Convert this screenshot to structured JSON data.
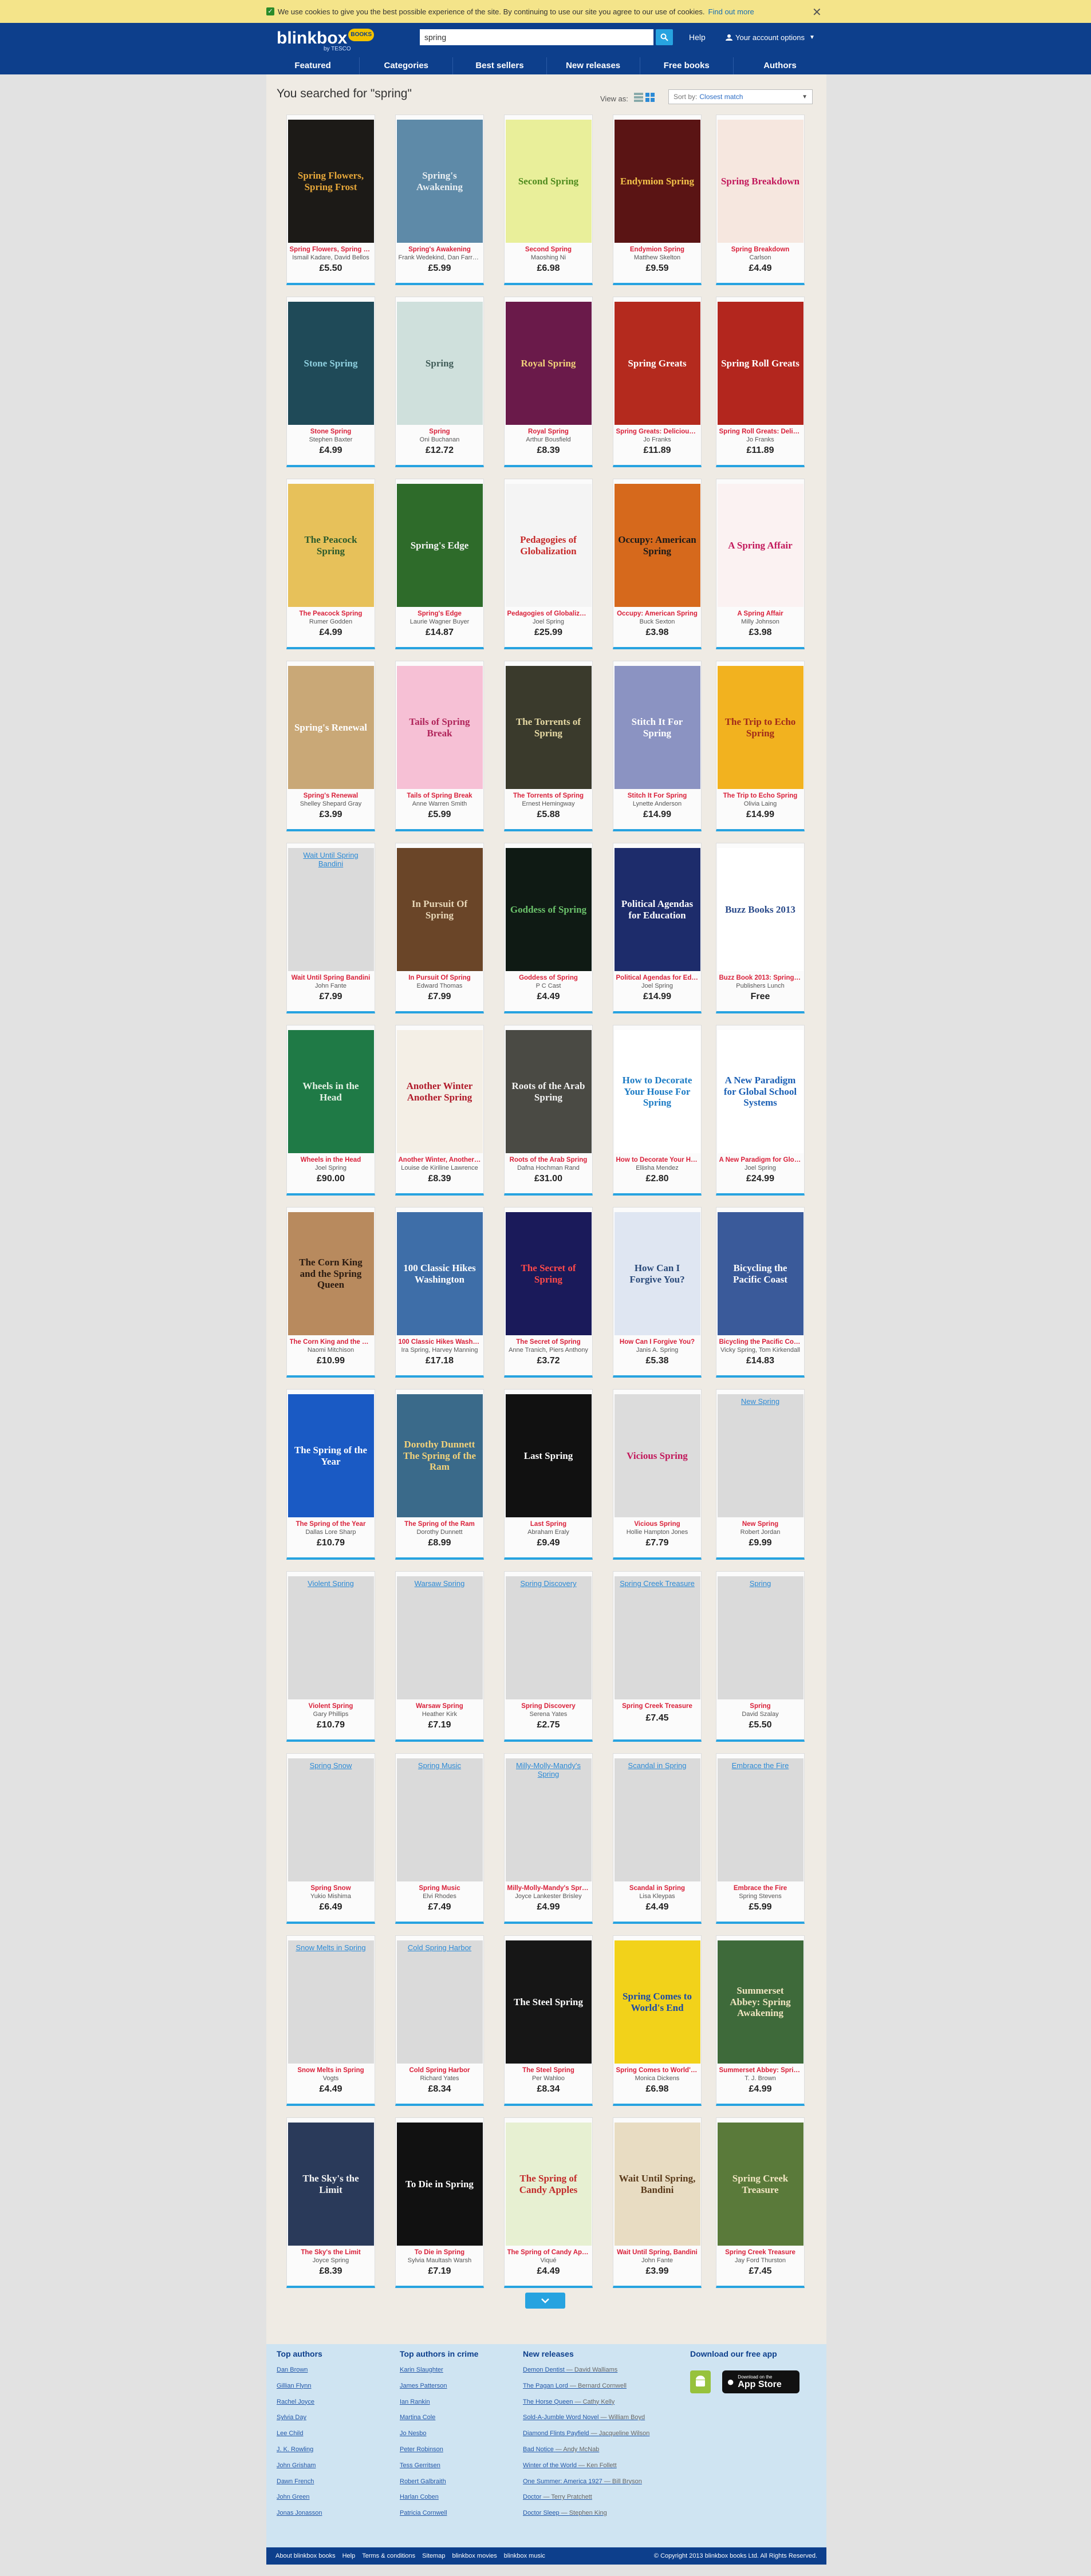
{
  "cookie": {
    "text": "We use cookies to give you the best possible experience of the site. By continuing to use our site you agree to our use of cookies.",
    "link": "Find out more",
    "close": "✕"
  },
  "header": {
    "logo": "blinkbox",
    "logo_badge": "BOOKS",
    "sub": "by TESCO",
    "search_value": "spring",
    "help": "Help",
    "account": "Your account options"
  },
  "nav": [
    "Featured",
    "Categories",
    "Best sellers",
    "New releases",
    "Free books",
    "Authors"
  ],
  "results": {
    "title": "You searched for \"spring\"",
    "view_as": "View as:",
    "sort_label": "Sort by:",
    "sort_value": "Closest match"
  },
  "books": [
    {
      "t": "Spring Flowers, Spring Frost",
      "a": "Ismail Kadare, David Bellos",
      "p": "£5.50",
      "cover": "Spring Flowers, Spring Frost",
      "bg": "#1c1a17",
      "fg": "#e8a83a"
    },
    {
      "t": "Spring's Awakening",
      "a": "Frank Wedekind, Dan Farrelly",
      "p": "£5.99",
      "cover": "Spring's Awakening",
      "bg": "#5e8aa8",
      "fg": "#e8eef2"
    },
    {
      "t": "Second Spring",
      "a": "Maoshing Ni",
      "p": "£6.98",
      "cover": "Second Spring",
      "bg": "#e9ef9a",
      "fg": "#4f8b1e"
    },
    {
      "t": "Endymion Spring",
      "a": "Matthew Skelton",
      "p": "£9.59",
      "cover": "Endymion Spring",
      "bg": "#5a1414",
      "fg": "#f2c24a"
    },
    {
      "t": "Spring Breakdown",
      "a": "Carlson",
      "p": "£4.49",
      "cover": "Spring Breakdown",
      "bg": "#f6e7df",
      "fg": "#c2185b"
    },
    {
      "t": "Stone Spring",
      "a": "Stephen Baxter",
      "p": "£4.99",
      "cover": "Stone Spring",
      "bg": "#1f4a58",
      "fg": "#8fd0e0"
    },
    {
      "t": "Spring",
      "a": "Oni Buchanan",
      "p": "£12.72",
      "cover": "Spring",
      "bg": "#cfe0dc",
      "fg": "#405c58"
    },
    {
      "t": "Royal Spring",
      "a": "Arthur Bousfield",
      "p": "£8.39",
      "cover": "Royal Spring",
      "bg": "#6a1a4a",
      "fg": "#f2d27a"
    },
    {
      "t": "Spring Greats: Delicious Recipes",
      "a": "Jo Franks",
      "p": "£11.89",
      "cover": "Spring Greats",
      "bg": "#b42a1e",
      "fg": "#ffffff"
    },
    {
      "t": "Spring Roll Greats: Delicious Recipes",
      "a": "Jo Franks",
      "p": "£11.89",
      "cover": "Spring Roll Greats",
      "bg": "#b3261e",
      "fg": "#ffffff"
    },
    {
      "t": "The Peacock Spring",
      "a": "Rumer Godden",
      "p": "£4.99",
      "cover": "The Peacock Spring",
      "bg": "#e7c15a",
      "fg": "#2b5a2b"
    },
    {
      "t": "Spring's Edge",
      "a": "Laurie Wagner Buyer",
      "p": "£14.87",
      "cover": "Spring's Edge",
      "bg": "#2e6b2a",
      "fg": "#f4f4f4"
    },
    {
      "t": "Pedagogies of Globalization",
      "a": "Joel Spring",
      "p": "£25.99",
      "cover": "Pedagogies of Globalization",
      "bg": "#f4f4f4",
      "fg": "#c62828"
    },
    {
      "t": "Occupy: American Spring",
      "a": "Buck Sexton",
      "p": "£3.98",
      "cover": "Occupy: American Spring",
      "bg": "#d6691c",
      "fg": "#1a1a1a"
    },
    {
      "t": "A Spring Affair",
      "a": "Milly Johnson",
      "p": "£3.98",
      "cover": "A Spring Affair",
      "bg": "#fbf2f2",
      "fg": "#c2185b"
    },
    {
      "t": "Spring's Renewal",
      "a": "Shelley Shepard Gray",
      "p": "£3.99",
      "cover": "Spring's Renewal",
      "bg": "#c9a877",
      "fg": "#ffffff"
    },
    {
      "t": "Tails of Spring Break",
      "a": "Anne Warren Smith",
      "p": "£5.99",
      "cover": "Tails of Spring Break",
      "bg": "#f6c0d5",
      "fg": "#b0245a"
    },
    {
      "t": "The Torrents of Spring",
      "a": "Ernest Hemingway",
      "p": "£5.88",
      "cover": "The Torrents of Spring",
      "bg": "#3a3a2c",
      "fg": "#e6d9a4"
    },
    {
      "t": "Stitch It For Spring",
      "a": "Lynette Anderson",
      "p": "£14.99",
      "cover": "Stitch It For Spring",
      "bg": "#8b93c2",
      "fg": "#ffffff"
    },
    {
      "t": "The Trip to Echo Spring",
      "a": "Olivia Laing",
      "p": "£14.99",
      "cover": "The Trip to Echo Spring",
      "bg": "#f2b21f",
      "fg": "#a12a1a"
    },
    {
      "t": "Wait Until Spring Bandini",
      "a": "John Fante",
      "p": "£7.99",
      "cover": "Wait Until Spring Bandini",
      "bg": "",
      "fg": ""
    },
    {
      "t": "In Pursuit Of Spring",
      "a": "Edward Thomas",
      "p": "£7.99",
      "cover": "In Pursuit Of Spring",
      "bg": "#6a4528",
      "fg": "#e8d7b8"
    },
    {
      "t": "Goddess of Spring",
      "a": "P C Cast",
      "p": "£4.49",
      "cover": "Goddess of Spring",
      "bg": "#0f1a14",
      "fg": "#6bc26b"
    },
    {
      "t": "Political Agendas for Education",
      "a": "Joel Spring",
      "p": "£14.99",
      "cover": "Political Agendas for Education",
      "bg": "#1d2c6b",
      "fg": "#ffffff"
    },
    {
      "t": "Buzz Book 2013: Spring/Summer",
      "a": "Publishers Lunch",
      "p": "Free",
      "cover": "Buzz Books 2013",
      "bg": "#ffffff",
      "fg": "#2a4a8a"
    },
    {
      "t": "Wheels in the Head",
      "a": "Joel Spring",
      "p": "£90.00",
      "cover": "Wheels in the Head",
      "bg": "#1f7a46",
      "fg": "#e6f2e6"
    },
    {
      "t": "Another Winter, Another Spring",
      "a": "Louise de Kiriline Lawrence",
      "p": "£8.39",
      "cover": "Another Winter Another Spring",
      "bg": "#f4efe6",
      "fg": "#b01a2a"
    },
    {
      "t": "Roots of the Arab Spring",
      "a": "Dafna Hochman Rand",
      "p": "£31.00",
      "cover": "Roots of the Arab Spring",
      "bg": "#4a4a44",
      "fg": "#f4f4f4"
    },
    {
      "t": "How to Decorate Your House For Spring",
      "a": "Ellisha Mendez",
      "p": "£2.80",
      "cover": "How to Decorate Your House For Spring",
      "bg": "#ffffff",
      "fg": "#1a7ac4"
    },
    {
      "t": "A New Paradigm for Global School Systems",
      "a": "Joel Spring",
      "p": "£24.99",
      "cover": "A New Paradigm for Global School Systems",
      "bg": "#ffffff",
      "fg": "#1a5fb4"
    },
    {
      "t": "The Corn King and the Spring Queen",
      "a": "Naomi Mitchison",
      "p": "£10.99",
      "cover": "The Corn King and the Spring Queen",
      "bg": "#b88a5e",
      "fg": "#2a1a10"
    },
    {
      "t": "100 Classic Hikes Washington",
      "a": "Ira Spring, Harvey Manning",
      "p": "£17.18",
      "cover": "100 Classic Hikes Washington",
      "bg": "#3e6ea8",
      "fg": "#ffffff"
    },
    {
      "t": "The Secret of Spring",
      "a": "Anne Tranich, Piers Anthony",
      "p": "£3.72",
      "cover": "The Secret of Spring",
      "bg": "#1a1a5a",
      "fg": "#ff4a4a"
    },
    {
      "t": "How Can I Forgive You?",
      "a": "Janis A. Spring",
      "p": "£5.38",
      "cover": "How Can I Forgive You?",
      "bg": "#dfe6f2",
      "fg": "#2a4a7a"
    },
    {
      "t": "Bicycling the Pacific Coast",
      "a": "Vicky Spring, Tom Kirkendall",
      "p": "£14.83",
      "cover": "Bicycling the Pacific Coast",
      "bg": "#3a5a9a",
      "fg": "#ffffff"
    },
    {
      "t": "The Spring of the Year",
      "a": "Dallas Lore Sharp",
      "p": "£10.79",
      "cover": "The Spring of the Year",
      "bg": "#1a5ac4",
      "fg": "#ffffff"
    },
    {
      "t": "The Spring of the Ram",
      "a": "Dorothy Dunnett",
      "p": "£8.99",
      "cover": "Dorothy Dunnett The Spring of the Ram",
      "bg": "#3a6a8a",
      "fg": "#f2d27a"
    },
    {
      "t": "Last Spring",
      "a": "Abraham Eraly",
      "p": "£9.49",
      "cover": "Last Spring",
      "bg": "#111111",
      "fg": "#ffffff"
    },
    {
      "t": "Vicious Spring",
      "a": "Hollie Hampton Jones",
      "p": "£7.79",
      "cover": "Vicious Spring",
      "bg": "#dcdcdc",
      "fg": "#c2185b"
    },
    {
      "t": "New Spring",
      "a": "Robert Jordan",
      "p": "£9.99",
      "cover": "New Spring",
      "bg": "",
      "fg": ""
    },
    {
      "t": "Violent Spring",
      "a": "Gary Phillips",
      "p": "£10.79",
      "cover": "Violent Spring",
      "bg": "",
      "fg": ""
    },
    {
      "t": "Warsaw Spring",
      "a": "Heather Kirk",
      "p": "£7.19",
      "cover": "Warsaw Spring",
      "bg": "",
      "fg": ""
    },
    {
      "t": "Spring Discovery",
      "a": "Serena Yates",
      "p": "£2.75",
      "cover": "Spring Discovery",
      "bg": "",
      "fg": ""
    },
    {
      "t": "Spring Creek Treasure",
      "a": "",
      "p": "£7.45",
      "cover": "Spring Creek Treasure",
      "bg": "",
      "fg": ""
    },
    {
      "t": "Spring",
      "a": "David Szalay",
      "p": "£5.50",
      "cover": "Spring",
      "bg": "",
      "fg": ""
    },
    {
      "t": "Spring Snow",
      "a": "Yukio Mishima",
      "p": "£6.49",
      "cover": "Spring Snow",
      "bg": "",
      "fg": ""
    },
    {
      "t": "Spring Music",
      "a": "Elvi Rhodes",
      "p": "£7.49",
      "cover": "Spring Music",
      "bg": "",
      "fg": ""
    },
    {
      "t": "Milly-Molly-Mandy's Spring",
      "a": "Joyce Lankester Brisley",
      "p": "£4.99",
      "cover": "Milly-Molly-Mandy's Spring",
      "bg": "",
      "fg": ""
    },
    {
      "t": "Scandal in Spring",
      "a": "Lisa Kleypas",
      "p": "£4.49",
      "cover": "Scandal in Spring",
      "bg": "",
      "fg": ""
    },
    {
      "t": "Embrace the Fire",
      "a": "Spring Stevens",
      "p": "£5.99",
      "cover": "Embrace the Fire",
      "bg": "",
      "fg": ""
    },
    {
      "t": "Snow Melts in Spring",
      "a": "Vogts",
      "p": "£4.49",
      "cover": "Snow Melts in Spring",
      "bg": "",
      "fg": ""
    },
    {
      "t": "Cold Spring Harbor",
      "a": "Richard Yates",
      "p": "£8.34",
      "cover": "Cold Spring Harbor",
      "bg": "",
      "fg": ""
    },
    {
      "t": "The Steel Spring",
      "a": "Per Wahloo",
      "p": "£8.34",
      "cover": "The Steel Spring",
      "bg": "#161616",
      "fg": "#ffffff"
    },
    {
      "t": "Spring Comes to World's End",
      "a": "Monica Dickens",
      "p": "£6.98",
      "cover": "Spring Comes to World's End",
      "bg": "#f2d21a",
      "fg": "#1a4aa8"
    },
    {
      "t": "Summerset Abbey: Spring Awakening",
      "a": "T. J. Brown",
      "p": "£4.99",
      "cover": "Summerset Abbey: Spring Awakening",
      "bg": "#3e6a3a",
      "fg": "#f2e6c2"
    },
    {
      "t": "The Sky's the Limit",
      "a": "Joyce Spring",
      "p": "£8.39",
      "cover": "The Sky's the Limit",
      "bg": "#2a3a5a",
      "fg": "#f4f4f4"
    },
    {
      "t": "To Die in Spring",
      "a": "Sylvia Maultash Warsh",
      "p": "£7.19",
      "cover": "To Die in Spring",
      "bg": "#111111",
      "fg": "#ffffff"
    },
    {
      "t": "The Spring of Candy Apples",
      "a": "Viqué",
      "p": "£4.49",
      "cover": "The Spring of Candy Apples",
      "bg": "#e7f0d2",
      "fg": "#c22a2a"
    },
    {
      "t": "Wait Until Spring, Bandini",
      "a": "John Fante",
      "p": "£3.99",
      "cover": "Wait Until Spring, Bandini",
      "bg": "#e8dcc2",
      "fg": "#5a3a1a"
    },
    {
      "t": "Spring Creek Treasure",
      "a": "Jay Ford Thurston",
      "p": "£7.45",
      "cover": "Spring Creek Treasure",
      "bg": "#5a7a3a",
      "fg": "#f2e6c2"
    }
  ],
  "footer": {
    "top_authors_title": "Top authors",
    "top_authors": [
      "Dan Brown",
      "Gillian Flynn",
      "Rachel Joyce",
      "Sylvia Day",
      "Lee Child",
      "J. K. Rowling",
      "John Grisham",
      "Dawn French",
      "John Green",
      "Jonas Jonasson"
    ],
    "crime_title": "Top authors in crime",
    "crime": [
      "Karin Slaughter",
      "James Patterson",
      "Ian Rankin",
      "Martina Cole",
      "Jo Nesbo",
      "Peter Robinson",
      "Tess Gerritsen",
      "Robert Galbraith",
      "Harlan Coben",
      "Patricia Cornwell"
    ],
    "releases_title": "New releases",
    "releases": [
      [
        "Demon Dentist",
        "David Walliams"
      ],
      [
        "The Pagan Lord",
        "Bernard Cornwell"
      ],
      [
        "The Horse Queen",
        "Cathy Kelly"
      ],
      [
        "Sold-A-Jumble Word Novel",
        "William Boyd"
      ],
      [
        "Diamond Flints Payfield",
        "Jacqueline Wilson"
      ],
      [
        "Bad Notice",
        "Andy McNab"
      ],
      [
        "Winter of the World",
        "Ken Follett"
      ],
      [
        "One Summer: America 1927",
        "Bill Bryson"
      ],
      [
        "Doctor",
        "Terry Pratchett"
      ],
      [
        "Doctor Sleep",
        "Stephen King"
      ]
    ],
    "download_title": "Download our free app",
    "appstore_small": "Download on the",
    "appstore": "App Store",
    "bar_links": [
      "About blinkbox books",
      "Help",
      "Terms & conditions",
      "Sitemap",
      "blinkbox movies",
      "blinkbox music"
    ],
    "copyright": "© Copyright 2013 blinkbox books Ltd. All Rights Reserved."
  }
}
